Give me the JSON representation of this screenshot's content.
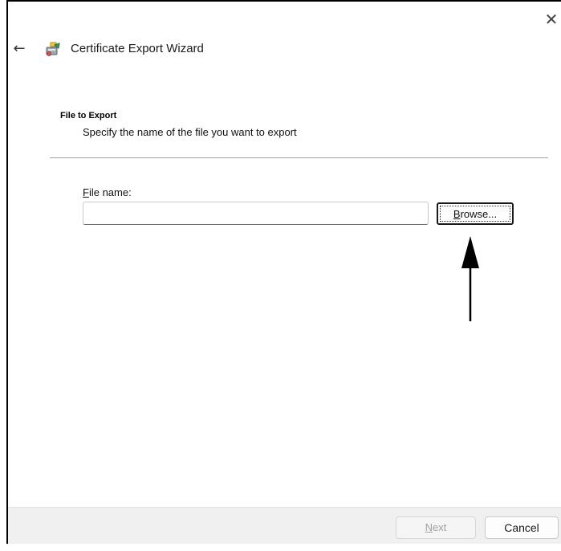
{
  "window": {
    "close_glyph": "✕",
    "back_glyph": "←",
    "title": "Certificate Export Wizard",
    "title_icon": "certificate-wizard-icon"
  },
  "page": {
    "section_title": "File to Export",
    "section_description": "Specify the name of the file you want to export"
  },
  "form": {
    "file_name_label_accel": "F",
    "file_name_label_rest": "ile name:",
    "file_name_value": "",
    "browse_accel": "B",
    "browse_rest": "rowse..."
  },
  "footer": {
    "next_accel": "N",
    "next_rest": "ext",
    "next_enabled": false,
    "cancel_label": "Cancel"
  },
  "colors": {
    "footer_bg": "#f0f0f0",
    "disabled_text": "#a0a0a0",
    "annotation_arrow": "#000000"
  }
}
